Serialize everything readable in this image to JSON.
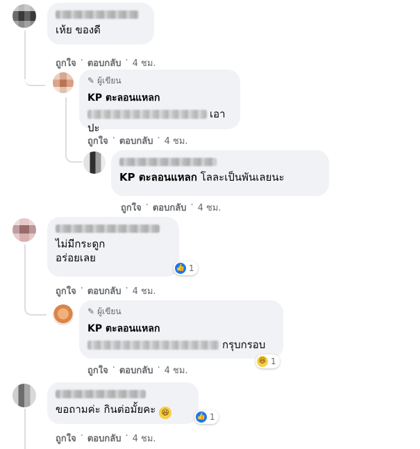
{
  "comments": [
    {
      "id": "c1",
      "author_name": "",
      "text": "เห้ย ของดี",
      "actions": {
        "like": "ถูกใจ",
        "reply": "ตอบกลับ",
        "time": "4 ชม."
      }
    },
    {
      "id": "c1-r1",
      "author_badge": "ผู้เขียน",
      "mention": "KP ตะลอนแหลก",
      "text_suffix": "เอาปะ",
      "actions": {
        "like": "ถูกใจ",
        "reply": "ตอบกลับ",
        "time": "4 ชม."
      }
    },
    {
      "id": "c1-r2",
      "mention": "KP ตะลอนแหลก",
      "text": "โลละเป็นพันเลยนะ",
      "actions": {
        "like": "ถูกใจ",
        "reply": "ตอบกลับ",
        "time": "4 ชม."
      }
    },
    {
      "id": "c2",
      "text_line1": "ไม่มีกระดูก",
      "text_line2": "อร่อยเลย",
      "reactions": {
        "type": "like",
        "count": "1"
      },
      "actions": {
        "like": "ถูกใจ",
        "reply": "ตอบกลับ",
        "time": "4 ชม."
      }
    },
    {
      "id": "c2-r1",
      "author_badge": "ผู้เขียน",
      "mention": "KP ตะลอนแหลก",
      "text_suffix": "กรุบกรอบ",
      "reactions": {
        "type": "haha",
        "count": "1"
      },
      "actions": {
        "like": "ถูกใจ",
        "reply": "ตอบกลับ",
        "time": "4 ชม."
      }
    },
    {
      "id": "c3",
      "text": "ขอถามค่ะ กินต่อมั้ยคะ",
      "reactions": {
        "type": "like",
        "count": "1"
      },
      "actions": {
        "like": "ถูกใจ",
        "reply": "ตอบกลับ",
        "time": "4 ชม."
      }
    }
  ],
  "icons": {
    "author_badge_icon": "pencil-icon",
    "like_reaction_icon": "thumbs-up-icon",
    "haha_reaction_icon": "laughing-emoji-icon",
    "inline_emoji": "laughing-emoji-icon"
  },
  "colors": {
    "bubble": "#f0f2f5",
    "meta_text": "#65676b",
    "like_blue": "#1877f2",
    "thread_line": "#dadde1"
  },
  "symbols": {
    "dot": "·"
  }
}
